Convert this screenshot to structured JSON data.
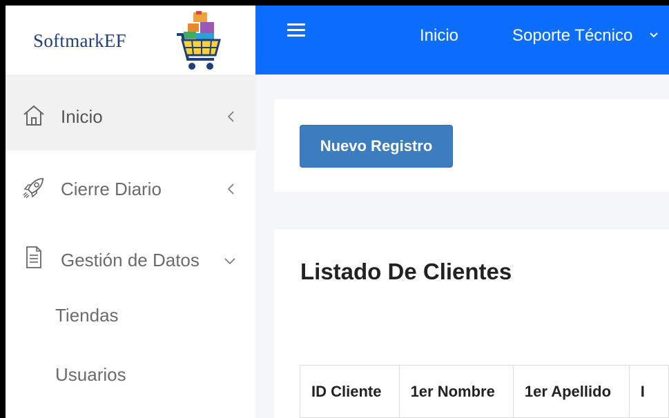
{
  "brand": {
    "name": "SoftmarkEF",
    "logo": "shopping-cart-logo"
  },
  "topbar": {
    "menu_icon": "hamburger-icon",
    "links": [
      {
        "label": "Inicio"
      },
      {
        "label": "Soporte Técnico"
      }
    ]
  },
  "sidebar": {
    "items": [
      {
        "label": "Inicio",
        "icon": "home-icon"
      },
      {
        "label": "Cierre Diario",
        "icon": "rocket-icon"
      },
      {
        "label": "Gestión de Datos",
        "icon": "document-icon"
      }
    ],
    "subitems": [
      {
        "label": "Tiendas"
      },
      {
        "label": "Usuarios"
      }
    ]
  },
  "main": {
    "new_button": "Nuevo Registro",
    "list_title": "Listado De Clientes",
    "table": {
      "headers": [
        "ID Cliente",
        "1er Nombre",
        "1er Apellido",
        "I"
      ]
    }
  },
  "colors": {
    "topbar": "#0d6efd",
    "button": "#3c7dbf",
    "brand_text": "#1f3f7a"
  }
}
